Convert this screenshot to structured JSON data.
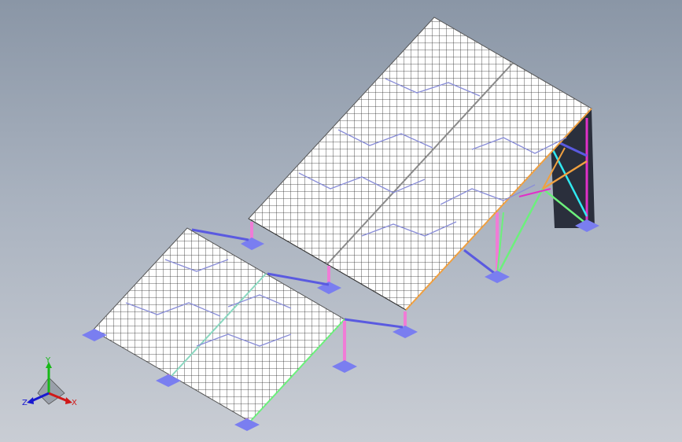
{
  "scene": {
    "view": "isometric",
    "background_top": "#8a96a6",
    "background_bottom": "#c9cdd4",
    "panel_fill": "#ffffff",
    "panel_grid_color": "#2a2a2a",
    "panel_wire_color": "#8a8ed8",
    "leg_color": "#f07cd6",
    "base_plate_color": "#7a7ef0",
    "brace_blue": "#5a5ae0",
    "brace_green": "#6cf07c",
    "brace_cyan": "#30e8f0",
    "brace_orange": "#f0a040",
    "frame_magenta": "#e030c8",
    "shadow_color": "#2a2f3c"
  },
  "triad": {
    "x_label": "X",
    "y_label": "Y",
    "z_label": "Z",
    "x_color": "#d01818",
    "y_color": "#18b818",
    "z_color": "#1818d0"
  }
}
